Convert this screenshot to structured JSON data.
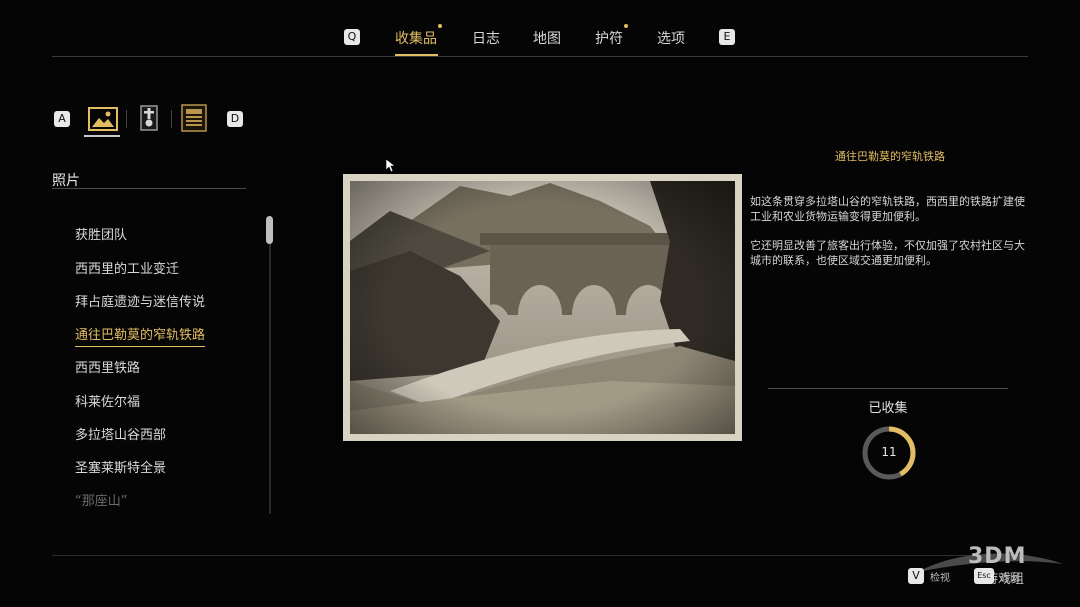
{
  "nav": {
    "left_key": "Q",
    "right_key": "E",
    "tabs": [
      {
        "label": "收集品",
        "active": true,
        "dot": true
      },
      {
        "label": "日志",
        "active": false,
        "dot": false
      },
      {
        "label": "地图",
        "active": false,
        "dot": false
      },
      {
        "label": "护符",
        "active": false,
        "dot": true
      },
      {
        "label": "选项",
        "active": false,
        "dot": false
      }
    ]
  },
  "categories": {
    "left_key": "A",
    "right_key": "D",
    "items": [
      {
        "icon": "photo-icon",
        "active": true
      },
      {
        "icon": "tombstone-icon",
        "active": false
      },
      {
        "icon": "document-icon",
        "active": false
      }
    ]
  },
  "list": {
    "title": "照片",
    "items": [
      {
        "label": "获胜团队"
      },
      {
        "label": "西西里的工业变迁"
      },
      {
        "label": "拜占庭遗迹与迷信传说"
      },
      {
        "label": "通往巴勒莫的窄轨铁路",
        "selected": true
      },
      {
        "label": "西西里铁路"
      },
      {
        "label": "科莱佐尔福"
      },
      {
        "label": "多拉塔山谷西部"
      },
      {
        "label": "圣塞莱斯特全景"
      },
      {
        "label": "“那座山”",
        "faded": true
      }
    ]
  },
  "detail": {
    "title": "通往巴勒莫的窄轨铁路",
    "paragraph1": "如这条贯穿多拉塔山谷的窄轨铁路，西西里的铁路扩建使工业和农业货物运输变得更加便利。",
    "paragraph2": "它还明显改善了旅客出行体验，不仅加强了农村社区与大城市的联系，也使区域交通更加便利。",
    "collected_label": "已收集",
    "collected_count": "11",
    "collected_progress": 0.42
  },
  "footer": {
    "key_v": "V",
    "key_v_label": "检视",
    "key_esc": "Esc",
    "key_esc_label": "返回",
    "watermark": "3DM",
    "watermark_sub": "游戏组"
  },
  "colors": {
    "accent": "#e2bd63",
    "background": "#050505"
  }
}
